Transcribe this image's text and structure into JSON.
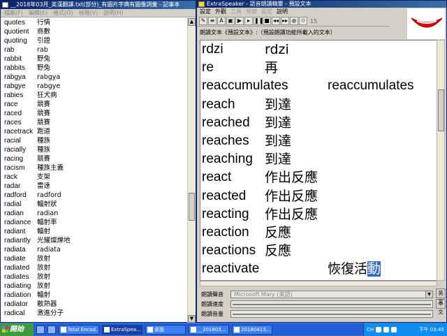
{
  "left_window": {
    "title": "__2018年03月_英漢翻譯.txt(部分)_有圖片字典有圖像詞彙 - 記事本",
    "menu": [
      "檔案(F)",
      "編輯(E)",
      "格式(O)",
      "檢視(V)",
      "說明(H)"
    ],
    "entries": [
      {
        "word": "quotes",
        "meaning": "行情"
      },
      {
        "word": "quotient",
        "meaning": "商數"
      },
      {
        "word": "quoting",
        "meaning": "引證"
      },
      {
        "word": "rab",
        "meaning": "rab"
      },
      {
        "word": "rabbit",
        "meaning": "野兔"
      },
      {
        "word": "rabbits",
        "meaning": "野兔"
      },
      {
        "word": "rabgya",
        "meaning": "rabgya"
      },
      {
        "word": "rabgye",
        "meaning": "rabgye"
      },
      {
        "word": "rabies",
        "meaning": "狂犬病"
      },
      {
        "word": "race",
        "meaning": "競賽"
      },
      {
        "word": "raced",
        "meaning": "競賽"
      },
      {
        "word": "races",
        "meaning": "競賽"
      },
      {
        "word": "racetrack",
        "meaning": "跑道"
      },
      {
        "word": "racial",
        "meaning": "種族"
      },
      {
        "word": "racially",
        "meaning": "種族"
      },
      {
        "word": "racing",
        "meaning": "競賽"
      },
      {
        "word": "racism",
        "meaning": "種族主義"
      },
      {
        "word": "rack",
        "meaning": "支架"
      },
      {
        "word": "radar",
        "meaning": "雷達"
      },
      {
        "word": "radford",
        "meaning": "radford"
      },
      {
        "word": "radial",
        "meaning": "輻射狀"
      },
      {
        "word": "radian",
        "meaning": "radian"
      },
      {
        "word": "radiance",
        "meaning": "輻射率"
      },
      {
        "word": "radiant",
        "meaning": "輻射"
      },
      {
        "word": "radiantly",
        "meaning": "光耀燦爍地"
      },
      {
        "word": "radiata",
        "meaning": "radiata"
      },
      {
        "word": "radiate",
        "meaning": "放射"
      },
      {
        "word": "radiated",
        "meaning": "放射"
      },
      {
        "word": "radiates",
        "meaning": "放射"
      },
      {
        "word": "radiating",
        "meaning": "放射"
      },
      {
        "word": "radiation",
        "meaning": "輻射"
      },
      {
        "word": "radiator",
        "meaning": "散熱器"
      },
      {
        "word": "radical",
        "meaning": "激進分子"
      }
    ]
  },
  "right_window": {
    "title": "ExtraSpeaker - 語音朗讀精靈 - 預設文本",
    "menu": [
      "設定",
      "外觀",
      "工具",
      "視窗",
      "設定",
      "說明"
    ],
    "subtitle": "朗讀文本《預設文本》:（預設朗讀功能所載入的文本）",
    "font_size": "15",
    "reading_rows": [
      {
        "word": "rdzi",
        "meaning": "rdzi",
        "layout": "near"
      },
      {
        "word": "re",
        "meaning": "再",
        "layout": "near"
      },
      {
        "word": "reaccumulates",
        "meaning": "reaccumulates",
        "layout": "far"
      },
      {
        "word": "reach",
        "meaning": "到達",
        "layout": "near"
      },
      {
        "word": "reached",
        "meaning": "到達",
        "layout": "near"
      },
      {
        "word": "reaches",
        "meaning": "到達",
        "layout": "near"
      },
      {
        "word": "reaching",
        "meaning": "到達",
        "layout": "near"
      },
      {
        "word": "react",
        "meaning": "作出反應",
        "layout": "near"
      },
      {
        "word": "reacted",
        "meaning": "作出反應",
        "layout": "near"
      },
      {
        "word": "reacting",
        "meaning": "作出反應",
        "layout": "near"
      },
      {
        "word": "reaction",
        "meaning": "反應",
        "layout": "near"
      },
      {
        "word": "reactions",
        "meaning": "反應",
        "layout": "near"
      },
      {
        "word": "reactivate",
        "meaning": "恢復活",
        "highlight": "動",
        "layout": "far2"
      }
    ],
    "voice_label": "朗讀聲音",
    "voice_value": "Microsoft Mary (英語)",
    "speed_label": "朗讀速度",
    "volume_label": "朗讀音量",
    "side_buttons": [
      "英文",
      "中文"
    ]
  },
  "taskbar": {
    "start_label": "開始",
    "tasks": [
      "Total Encod...",
      "ExtraSpea...",
      "桌面",
      "__201803...",
      "20180413..."
    ],
    "tray_lang": "CH",
    "clock": "下午 03:45"
  }
}
